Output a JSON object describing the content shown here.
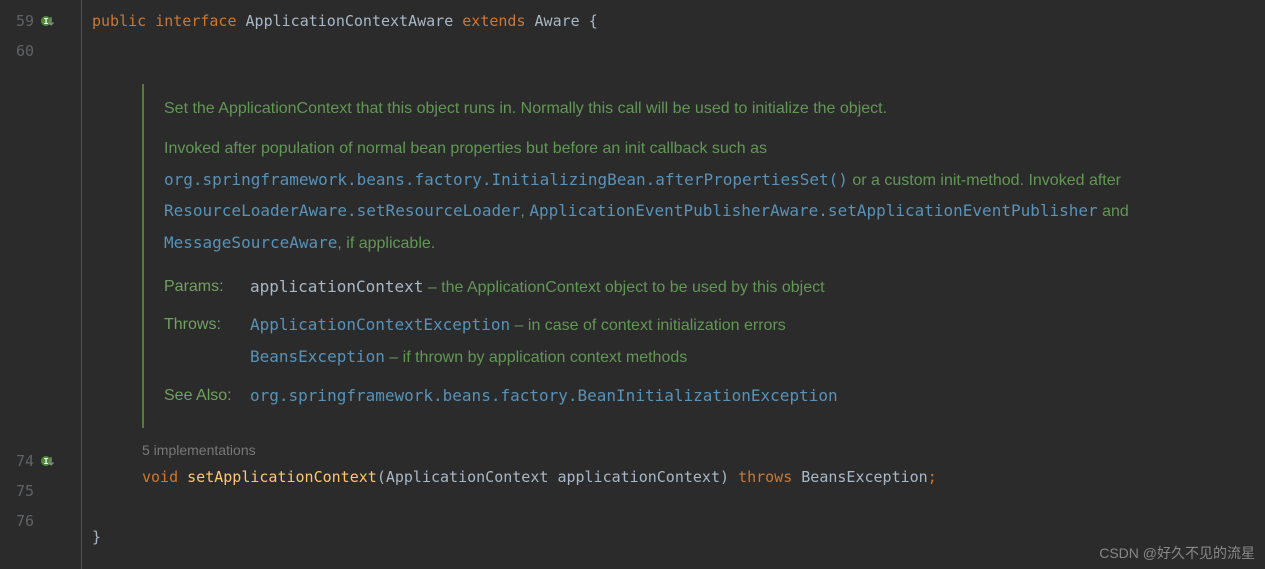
{
  "gutter": {
    "lines": [
      "59",
      "60",
      "74",
      "75",
      "76"
    ]
  },
  "code": {
    "line59": {
      "kw_public": "public",
      "kw_interface": "interface",
      "class_name": "ApplicationContextAware",
      "kw_extends": "extends",
      "super_name": "Aware",
      "brace": " {"
    },
    "impl_hint": "5 implementations",
    "line74": {
      "kw_void": "void",
      "method": "setApplicationContext",
      "paren_open": "(",
      "param_type": "ApplicationContext",
      "param_name": "applicationContext",
      "paren_close": ")",
      "kw_throws": "throws",
      "exception": "BeansException",
      "semi": ";"
    },
    "line76": {
      "brace": "}"
    }
  },
  "javadoc": {
    "para1": "Set the ApplicationContext that this object runs in. Normally this call will be used to initialize the object.",
    "para2_a": "Invoked after population of normal bean properties but before an init callback such as ",
    "para2_link1": "org.springframework.beans.factory.InitializingBean.afterPropertiesSet()",
    "para2_b": " or a custom init-method. Invoked after ",
    "para2_link2": "ResourceLoaderAware.setResourceLoader",
    "para2_c": ", ",
    "para2_link3": "ApplicationEventPublisherAware.setApplicationEventPublisher",
    "para2_d": " and ",
    "para2_link4": "MessageSourceAware",
    "para2_e": ", if applicable.",
    "tags": {
      "params_label": "Params:",
      "params_name": "applicationContext",
      "params_desc": " – the ApplicationContext object to be used by this object",
      "throws_label": "Throws:",
      "throws1_name": "ApplicationContextException",
      "throws1_desc": " – in case of context initialization errors",
      "throws2_name": "BeansException",
      "throws2_desc": " – if thrown by application context methods",
      "seealso_label": "See Also:",
      "seealso_link": "org.springframework.beans.factory.BeanInitializationException"
    }
  },
  "watermark": "CSDN @好久不见的流星"
}
